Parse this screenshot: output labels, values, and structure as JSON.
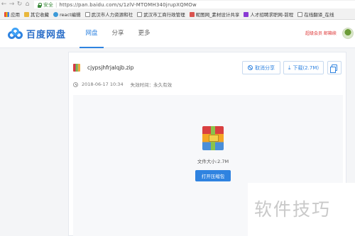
{
  "browser": {
    "secure_label": "安全",
    "url": "https://pan.baidu.com/s/1zlV-MTOMH340jrupXQMOw",
    "bookmarks": [
      {
        "label": "应用",
        "icon": "apps-grid-icon"
      },
      {
        "label": "其它收藏",
        "icon": "folder-icon"
      },
      {
        "label": "react编辑",
        "icon": "react-icon"
      },
      {
        "label": "武汉市人力资源和社",
        "icon": "page-icon"
      },
      {
        "label": "武汉市工商行政管理",
        "icon": "page-icon"
      },
      {
        "label": "昵图网_素材设计共享",
        "icon": "red-logo-icon"
      },
      {
        "label": "人才招聘求职网-前程",
        "icon": "purple-logo-icon"
      },
      {
        "label": "在线翻译_在线",
        "icon": "page-icon"
      }
    ]
  },
  "header": {
    "logo_text": "百度网盘",
    "nav": [
      {
        "label": "网盘",
        "active": true
      },
      {
        "label": "分享",
        "active": false
      },
      {
        "label": "更多",
        "active": false
      }
    ],
    "user_link": "超级会员 邮箱续"
  },
  "share": {
    "file_name": "cjypsjhfrjalqjb.zip",
    "date": "2018-06-17 10:34",
    "expire": "失效时间：永久有效",
    "cancel_label": "取消分享",
    "download_label": "下载(2.7M)",
    "file_size": "文件大小:2.7M",
    "open_label": "打开压缩包"
  },
  "watermark": "软件技巧"
}
